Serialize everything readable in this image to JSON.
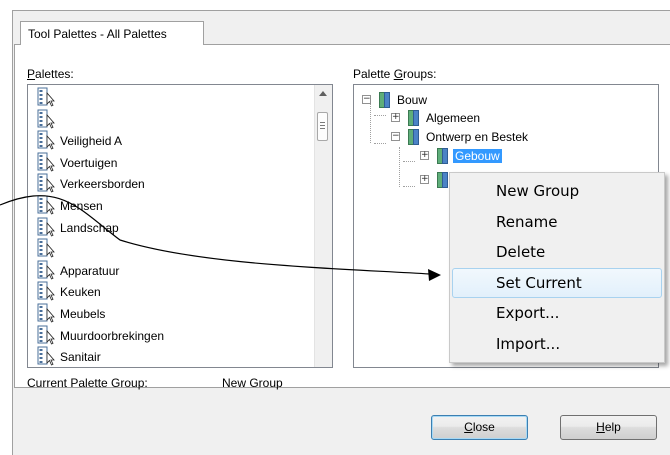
{
  "tab": {
    "label": "Tool Palettes - All Palettes"
  },
  "palettes": {
    "label_prefix_u": "P",
    "label_rest": "alettes:",
    "items": [
      "",
      "",
      "Veiligheid A",
      "Voertuigen",
      "Verkeersborden",
      "Mensen",
      "Landschap",
      "",
      "Apparatuur",
      "Keuken",
      "Meubels",
      "Muurdoorbrekingen",
      "Sanitair"
    ]
  },
  "groups": {
    "label_prefix": "Palette ",
    "label_u": "G",
    "label_rest": "roups:",
    "tree": [
      {
        "label": "Bouw",
        "expanded": true,
        "level": 0
      },
      {
        "label": "Algemeen",
        "expanded": false,
        "level": 1
      },
      {
        "label": "Ontwerp en Bestek",
        "expanded": true,
        "level": 1
      },
      {
        "label": "Gebouw",
        "expanded": false,
        "level": 2,
        "selected": true
      },
      {
        "label": "",
        "expanded": false,
        "level": 2
      }
    ]
  },
  "current": {
    "label": "Current Palette Group:",
    "value": "New Group"
  },
  "buttons": {
    "close_u": "C",
    "close_rest": "lose",
    "help_u": "H",
    "help_rest": "elp"
  },
  "context_menu": {
    "items": [
      "New Group",
      "Rename",
      "Delete",
      "Set Current",
      "Export...",
      "Import..."
    ],
    "highlighted": "Set Current"
  },
  "colors": {
    "selection": "#3399ff",
    "folder_green": "#5fae7a",
    "folder_blue": "#4b83c6"
  }
}
